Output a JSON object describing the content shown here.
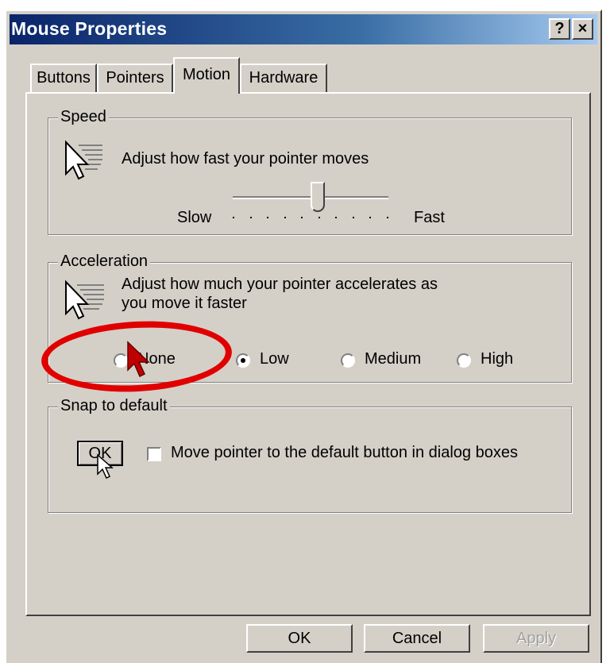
{
  "window": {
    "title": "Mouse Properties",
    "help_label": "?",
    "close_label": "×"
  },
  "tabs": [
    {
      "label": "Buttons",
      "active": false
    },
    {
      "label": "Pointers",
      "active": false
    },
    {
      "label": "Motion",
      "active": true
    },
    {
      "label": "Hardware",
      "active": false
    }
  ],
  "speed": {
    "legend": "Speed",
    "description": "Adjust how fast your pointer moves",
    "slow_label": "Slow",
    "fast_label": "Fast",
    "slider_fraction": 0.55
  },
  "acceleration": {
    "legend": "Acceleration",
    "description_line1": "Adjust how much your pointer accelerates as",
    "description_line2": "you move it faster",
    "options": [
      {
        "label": "None",
        "checked": false
      },
      {
        "label": "Low",
        "checked": true
      },
      {
        "label": "Medium",
        "checked": false
      },
      {
        "label": "High",
        "checked": false
      }
    ]
  },
  "snap": {
    "legend": "Snap to default",
    "sample_button_label": "OK",
    "checkbox_label": "Move pointer to the default button in dialog boxes",
    "checked": false
  },
  "footer": {
    "ok_label": "OK",
    "cancel_label": "Cancel",
    "apply_label": "Apply"
  },
  "annotation": {
    "highlight_color": "#e00000"
  }
}
